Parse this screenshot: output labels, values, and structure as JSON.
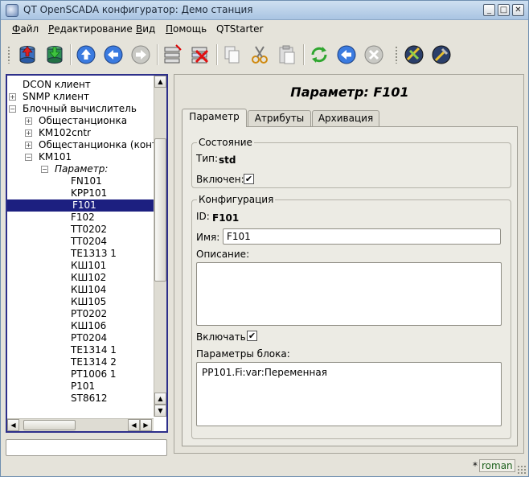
{
  "window": {
    "title": "QT OpenSCADA конфигуратор: Демо станция",
    "min_btn": "_",
    "max_btn": "□",
    "close_btn": "✕"
  },
  "menu": [
    {
      "label": "Файл",
      "mnemonic": "Ф",
      "rest": "айл"
    },
    {
      "label": "Редактирование",
      "mnemonic": "Р",
      "rest": "едактирование"
    },
    {
      "label": "Вид",
      "mnemonic": "В",
      "rest": "ид"
    },
    {
      "label": "Помощь",
      "mnemonic": "П",
      "rest": "омощь"
    },
    {
      "label": "QTStarter",
      "mnemonic": "",
      "rest": "QTStarter"
    }
  ],
  "toolbar": [
    {
      "name": "db-load-icon"
    },
    {
      "name": "db-save-icon"
    },
    {
      "name": "up-icon"
    },
    {
      "name": "back-icon"
    },
    {
      "name": "forward-icon"
    },
    {
      "name": "add-item-icon"
    },
    {
      "name": "delete-item-icon"
    },
    {
      "name": "copy-icon"
    },
    {
      "name": "cut-icon"
    },
    {
      "name": "paste-icon"
    },
    {
      "name": "refresh-icon"
    },
    {
      "name": "start-icon"
    },
    {
      "name": "stop-icon"
    },
    {
      "name": "ui-module-1-icon"
    },
    {
      "name": "ui-module-2-icon"
    }
  ],
  "tree": {
    "items": [
      {
        "label": "DCON клиент",
        "indent": 0,
        "exp": "",
        "italic": false
      },
      {
        "label": "SNMP клиент",
        "indent": 0,
        "exp": "+",
        "italic": false
      },
      {
        "label": "Блочный вычислитель",
        "indent": 0,
        "exp": "−",
        "italic": false
      },
      {
        "label": "Общестанционка",
        "indent": 1,
        "exp": "+",
        "italic": false
      },
      {
        "label": "KM102cntr",
        "indent": 1,
        "exp": "+",
        "italic": false
      },
      {
        "label": "Общестанционка (контр)",
        "indent": 1,
        "exp": "+",
        "italic": false
      },
      {
        "label": "KM101",
        "indent": 1,
        "exp": "−",
        "italic": false
      },
      {
        "label": "Параметр:",
        "indent": 2,
        "exp": "−",
        "italic": true
      },
      {
        "label": "FN101",
        "indent": 3,
        "exp": "",
        "italic": false
      },
      {
        "label": "KPP101",
        "indent": 3,
        "exp": "",
        "italic": false
      },
      {
        "label": "F101",
        "indent": 3,
        "exp": "",
        "italic": false,
        "selected": true
      },
      {
        "label": "F102",
        "indent": 3,
        "exp": "",
        "italic": false
      },
      {
        "label": "TT0202",
        "indent": 3,
        "exp": "",
        "italic": false
      },
      {
        "label": "TT0204",
        "indent": 3,
        "exp": "",
        "italic": false
      },
      {
        "label": "TE1313 1",
        "indent": 3,
        "exp": "",
        "italic": false
      },
      {
        "label": "КШ101",
        "indent": 3,
        "exp": "",
        "italic": false
      },
      {
        "label": "КШ102",
        "indent": 3,
        "exp": "",
        "italic": false
      },
      {
        "label": "КШ104",
        "indent": 3,
        "exp": "",
        "italic": false
      },
      {
        "label": "КШ105",
        "indent": 3,
        "exp": "",
        "italic": false
      },
      {
        "label": "PT0202",
        "indent": 3,
        "exp": "",
        "italic": false
      },
      {
        "label": "КШ106",
        "indent": 3,
        "exp": "",
        "italic": false
      },
      {
        "label": "PT0204",
        "indent": 3,
        "exp": "",
        "italic": false
      },
      {
        "label": "TE1314 1",
        "indent": 3,
        "exp": "",
        "italic": false
      },
      {
        "label": "TE1314 2",
        "indent": 3,
        "exp": "",
        "italic": false
      },
      {
        "label": "PT1006 1",
        "indent": 3,
        "exp": "",
        "italic": false
      },
      {
        "label": "P101",
        "indent": 3,
        "exp": "",
        "italic": false
      },
      {
        "label": "ST8612",
        "indent": 3,
        "exp": "",
        "italic": false
      }
    ]
  },
  "page": {
    "title": "Параметр: F101",
    "tabs": [
      "Параметр",
      "Атрибуты",
      "Архивация"
    ],
    "state_group": {
      "title": "Состояние",
      "type_label": "Тип:",
      "type_value": "std",
      "enabled_label": "Включен:",
      "enabled_checked": true
    },
    "config_group": {
      "title": "Конфигурация",
      "id_label": "ID:",
      "id_value": "F101",
      "name_label": "Имя:",
      "name_value": "F101",
      "descr_label": "Описание:",
      "descr_value": "",
      "enable_label": "Включать:",
      "enable_checked": true,
      "block_params_label": "Параметры блока:",
      "block_params_value": "PP101.Fi:var:Переменная"
    }
  },
  "status": {
    "modified_mark": "*",
    "language": "roman"
  },
  "colors": {
    "selection": "#1c1f80",
    "tree_border": "#2d2f8a",
    "lang_text": "#1a5f1a"
  }
}
